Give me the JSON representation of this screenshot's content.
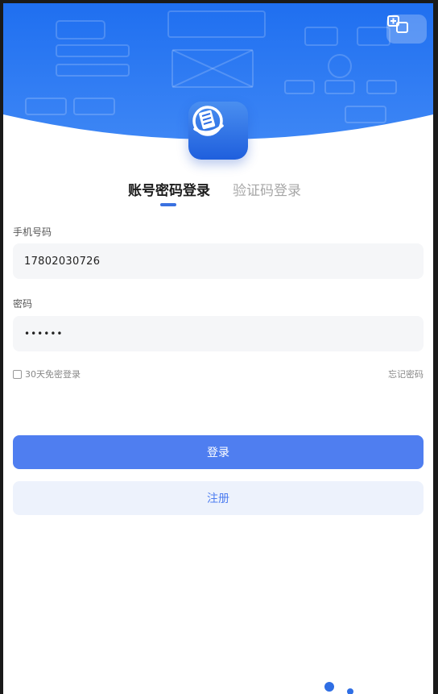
{
  "colors": {
    "header_top": "#1f6ff0",
    "header_bottom": "#3d86f5",
    "accent": "#4f7ef0",
    "register_bg": "#edf2fc"
  },
  "header": {
    "switch_icon": "swap-screen-icon",
    "logo_icon": "app-logo-icon"
  },
  "tabs": [
    {
      "label": "账号密码登录",
      "active": true
    },
    {
      "label": "验证码登录",
      "active": false
    }
  ],
  "form": {
    "phone": {
      "label": "手机号码",
      "value": "17802030726"
    },
    "password": {
      "label": "密码",
      "value": "••••••"
    },
    "remember_label": "30天免密登录",
    "forgot_label": "忘记密码"
  },
  "buttons": {
    "login": "登录",
    "register": "注册"
  }
}
